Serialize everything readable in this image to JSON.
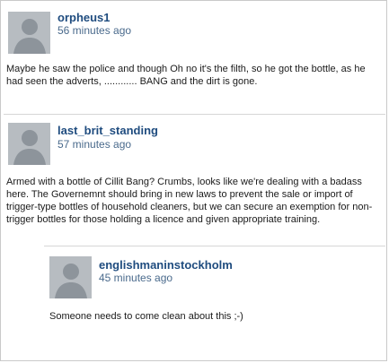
{
  "comments": [
    {
      "username": "orpheus1",
      "time": "56 minutes ago",
      "text": "Maybe he saw the police and though Oh no it's the filth, so he got the bottle, as he had seen the adverts, ............ BANG and the dirt is gone."
    },
    {
      "username": "last_brit_standing",
      "time": "57 minutes ago",
      "text": "Armed with a bottle of Cillit Bang? Crumbs, looks like we're dealing with a badass here. The Governemnt should bring in new laws to prevent the sale or import of trigger-type bottles of household cleaners, but we can secure an exemption for non-trigger bottles for those holding a licence and given appropriate training."
    },
    {
      "username": "englishmaninstockholm",
      "time": "45 minutes ago",
      "text": "Someone needs to come clean about this ;-)"
    }
  ],
  "colors": {
    "username": "#1f4c7f",
    "timestamp": "#4a6a8c",
    "avatar_bg": "#b7bcc1",
    "avatar_figure": "#8d949b"
  }
}
